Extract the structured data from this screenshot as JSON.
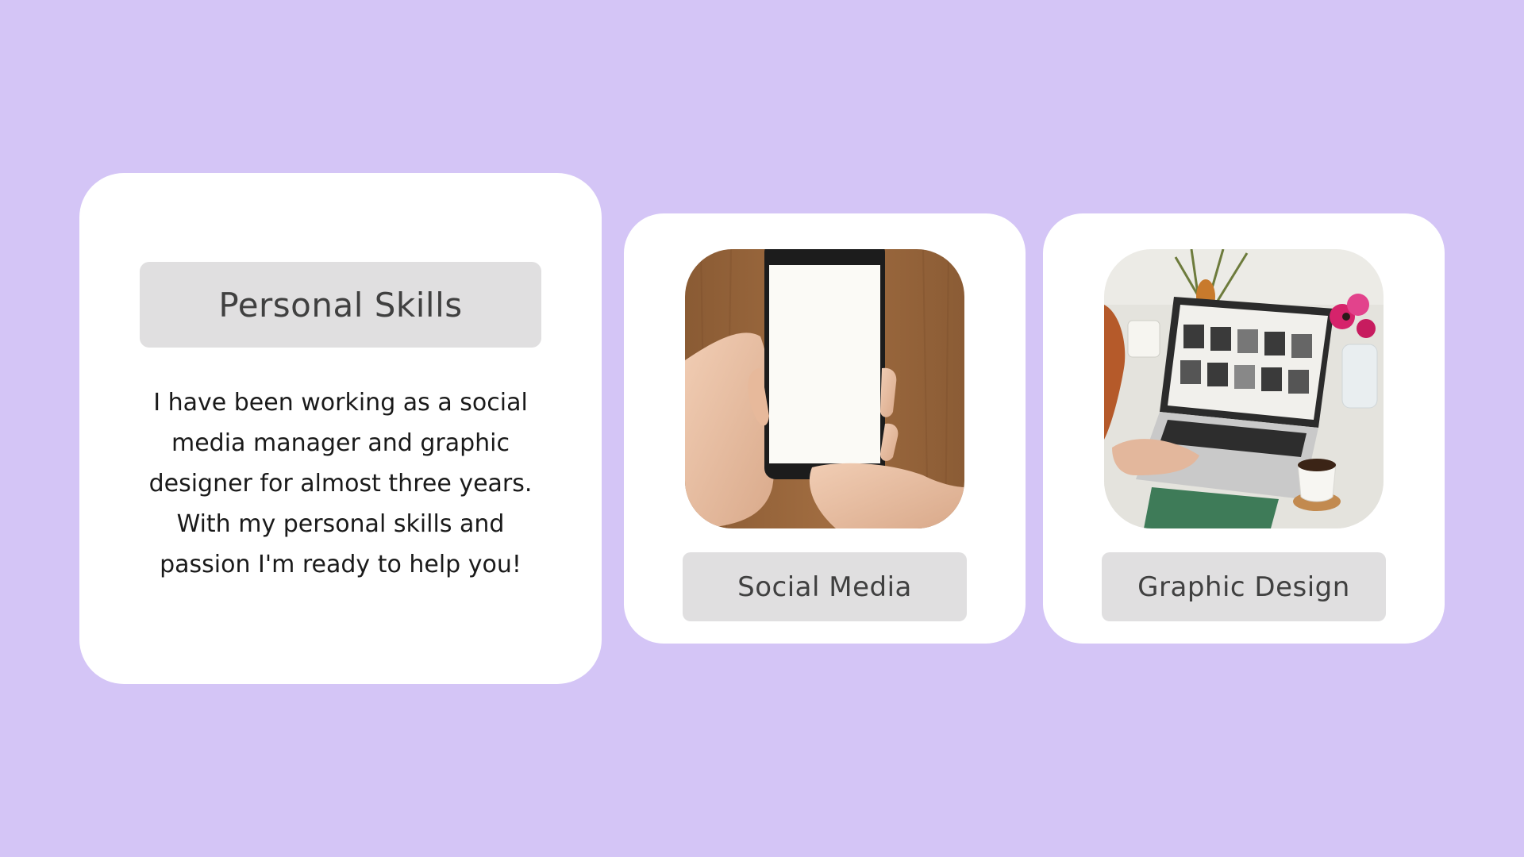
{
  "background_color": "#d4c5f6",
  "intro_card": {
    "title": "Personal Skills",
    "description": "I have been working as a social media manager and graphic designer for almost three years. With my personal skills and passion I'm ready to help you!"
  },
  "skill_cards": [
    {
      "label": "Social Media",
      "image": "hands-holding-smartphone-photo"
    },
    {
      "label": "Graphic Design",
      "image": "laptop-on-desk-photo"
    }
  ],
  "colors": {
    "card": "#ffffff",
    "pill": "#e0dfe0",
    "pill_text": "#404040",
    "body_text": "#1a1a1a"
  }
}
